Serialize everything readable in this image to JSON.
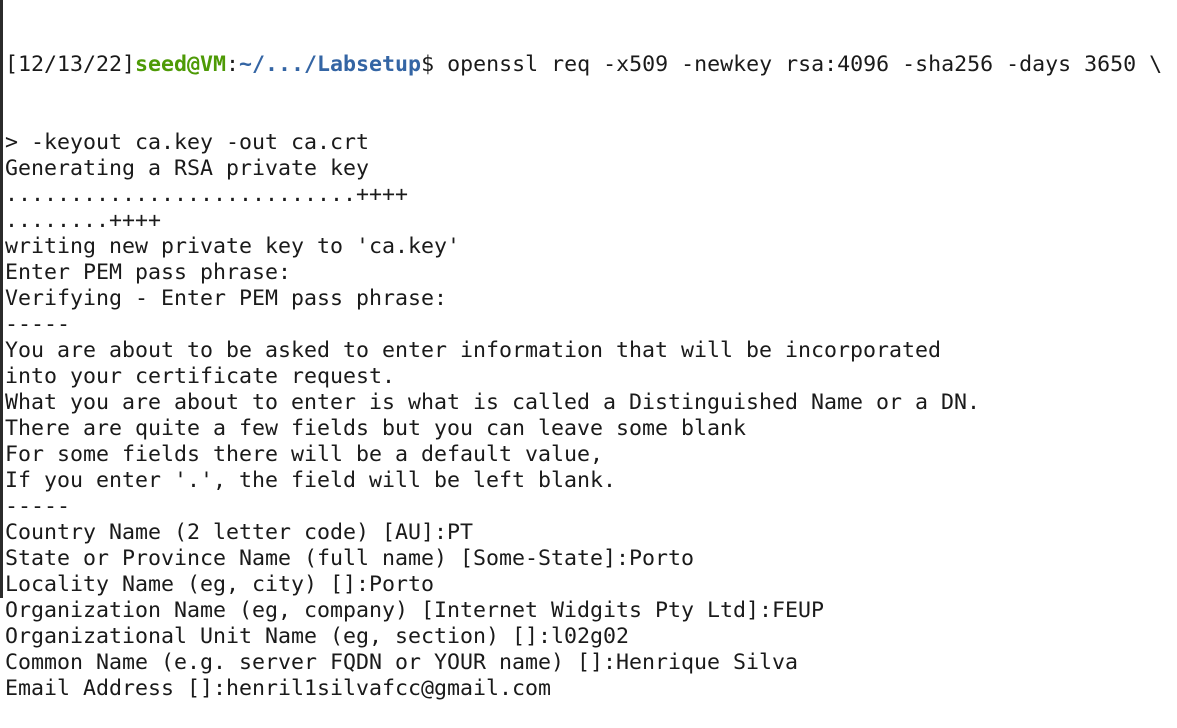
{
  "prompt": {
    "date": "[12/13/22]",
    "user_host": "seed@VM",
    "sep": ":",
    "path": "~/.../Labsetup",
    "symbol": "$ ",
    "command": "openssl req -x509 -newkey rsa:4096 -sha256 -days 3650 \\"
  },
  "colors": {
    "user": "#4e9a06",
    "path": "#3465a4"
  },
  "lines": [
    "> -keyout ca.key -out ca.crt",
    "Generating a RSA private key",
    "...........................++++",
    "........++++",
    "writing new private key to 'ca.key'",
    "Enter PEM pass phrase:",
    "Verifying - Enter PEM pass phrase:",
    "-----",
    "You are about to be asked to enter information that will be incorporated",
    "into your certificate request.",
    "What you are about to enter is what is called a Distinguished Name or a DN.",
    "There are quite a few fields but you can leave some blank",
    "For some fields there will be a default value,",
    "If you enter '.', the field will be left blank.",
    "-----",
    "Country Name (2 letter code) [AU]:PT",
    "State or Province Name (full name) [Some-State]:Porto",
    "Locality Name (eg, city) []:Porto",
    "Organization Name (eg, company) [Internet Widgits Pty Ltd]:FEUP",
    "Organizational Unit Name (eg, section) []:l02g02",
    "Common Name (e.g. server FQDN or YOUR name) []:Henrique Silva",
    "Email Address []:henril1silvafcc@gmail.com"
  ]
}
